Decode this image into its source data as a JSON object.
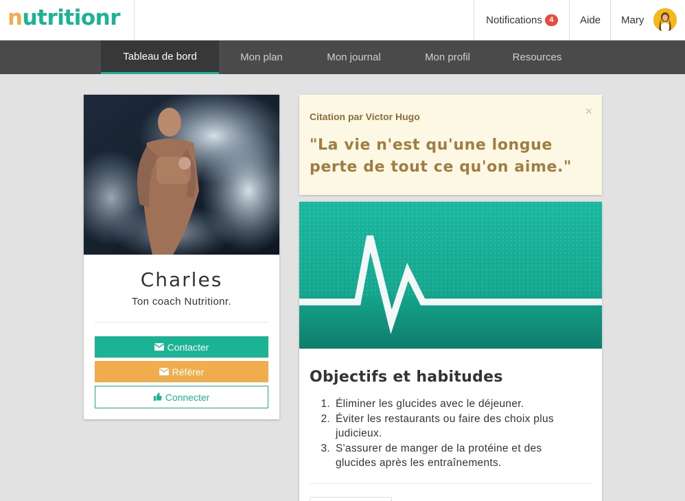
{
  "brand": {
    "logo_first": "n",
    "logo_rest": "utritionr"
  },
  "topbar": {
    "notifications_label": "Notifications",
    "notifications_count": "4",
    "help_label": "Aide",
    "user_name": "Mary"
  },
  "nav": {
    "items": [
      {
        "label": "Tableau de bord",
        "active": true
      },
      {
        "label": "Mon plan"
      },
      {
        "label": "Mon journal"
      },
      {
        "label": "Mon profil"
      },
      {
        "label": "Resources"
      }
    ]
  },
  "coach": {
    "name": "Charles",
    "subtitle": "Ton coach Nutritionr.",
    "contact_label": "Contacter",
    "refer_label": "Référer",
    "connect_label": "Connecter"
  },
  "quote": {
    "author": "Citation par Victor Hugo",
    "line1": "\"La vie n'est qu'une longue",
    "line2": "perte de tout ce qu'on aime.\"",
    "close": "×"
  },
  "goals": {
    "title": "Objectifs et habitudes",
    "items": [
      {
        "num": "1.",
        "text": "Éliminer les glucides avec le déjeuner."
      },
      {
        "num": "2.",
        "text": "Éviter les restaurants ou faire des choix plus judicieux."
      },
      {
        "num": "3.",
        "text": "S'assurer de manger de la protéine et des glucides après les entraînements."
      }
    ]
  },
  "colors": {
    "accent": "#1ab394",
    "warning": "#f0ad4e",
    "nav_bg": "#4a4a4a",
    "badge": "#e74c3c"
  },
  "icons": {
    "contact": "envelope-icon",
    "refer": "envelope-icon",
    "connect": "thumbs-up-icon",
    "close": "close-icon"
  }
}
